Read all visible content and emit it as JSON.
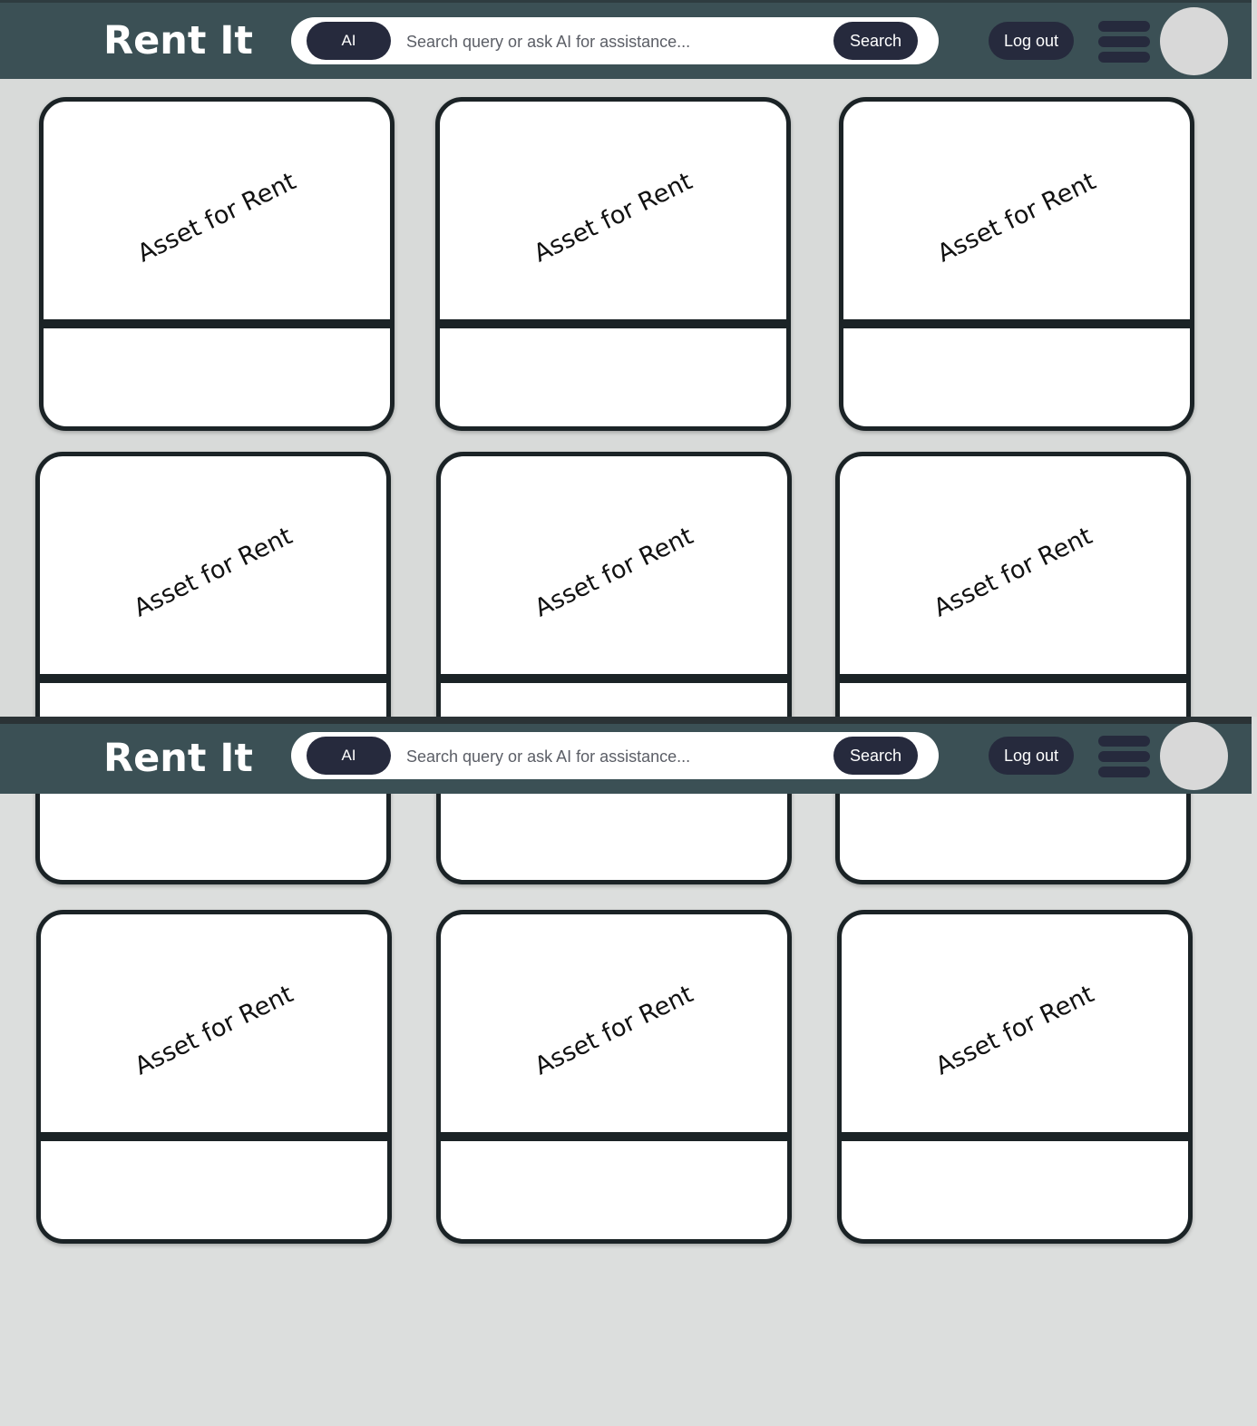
{
  "header": {
    "brand": "Rent It",
    "ai_label": "AI",
    "search_placeholder": "Search query or ask AI for assistance...",
    "search_label": "Search",
    "logout_label": "Log out",
    "menu_icon": "hamburger-menu-icon",
    "avatar": "user-avatar"
  },
  "listings": [
    {
      "title": "Asset for Rent"
    },
    {
      "title": "Asset for Rent"
    },
    {
      "title": "Asset for Rent"
    },
    {
      "title": "Asset for Rent"
    },
    {
      "title": "Asset for Rent"
    },
    {
      "title": "Asset for Rent"
    },
    {
      "title": "Asset for Rent"
    },
    {
      "title": "Asset for Rent"
    },
    {
      "title": "Asset for Rent"
    }
  ],
  "colors": {
    "header_bg": "#3b5055",
    "button_bg": "#262a3d",
    "card_border": "#1b2326",
    "page_bg": "#dcdedd"
  }
}
